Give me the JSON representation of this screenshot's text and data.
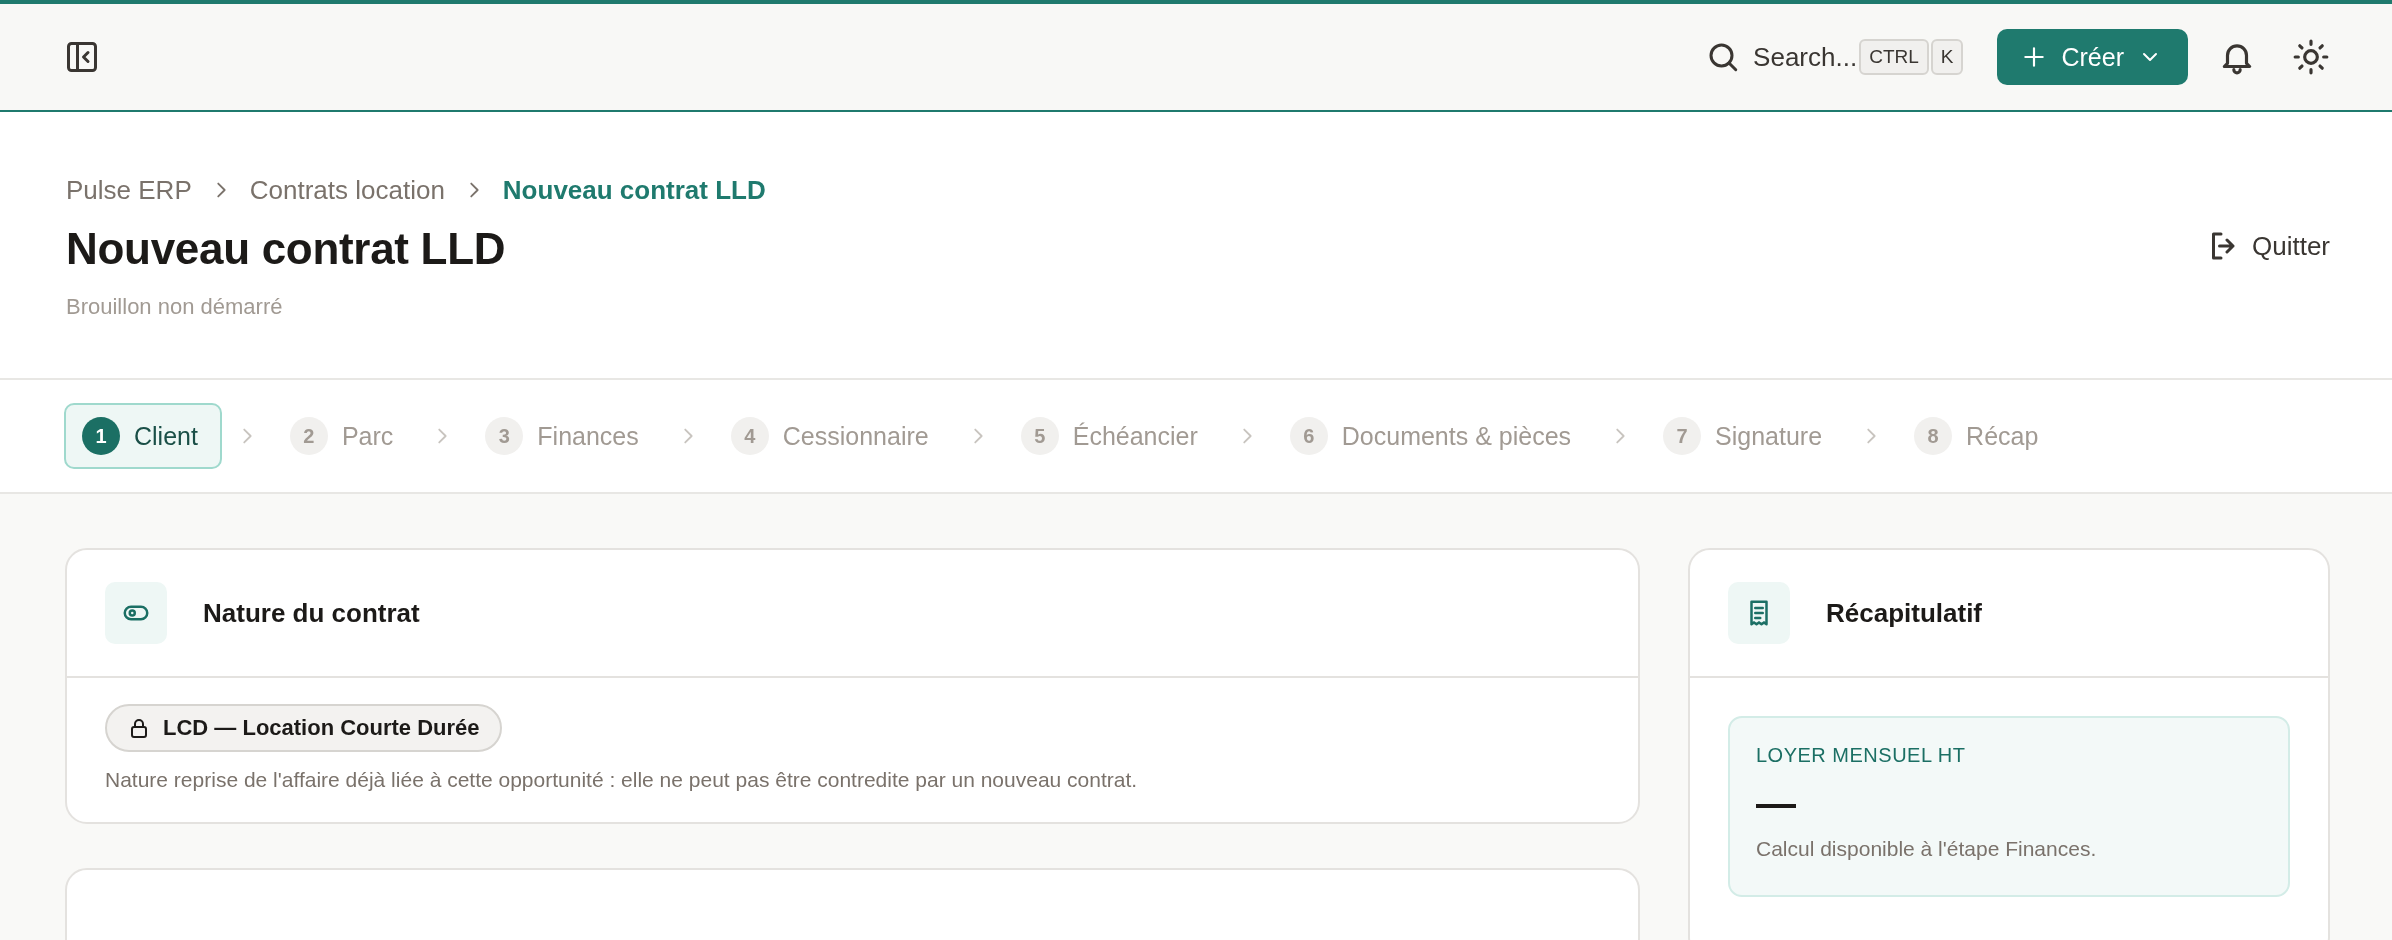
{
  "topbar": {
    "search_label": "Search...",
    "shortcut_keys": [
      "CTRL",
      "K"
    ],
    "create_button": "Créer"
  },
  "breadcrumbs": [
    {
      "label": "Pulse ERP",
      "current": false
    },
    {
      "label": "Contrats location",
      "current": false
    },
    {
      "label": "Nouveau contrat LLD",
      "current": true
    }
  ],
  "page": {
    "title": "Nouveau contrat LLD",
    "subtitle": "Brouillon non démarré",
    "quit_button": "Quitter"
  },
  "steps": [
    {
      "number": "1",
      "label": "Client",
      "selected": true
    },
    {
      "number": "2",
      "label": "Parc",
      "selected": false
    },
    {
      "number": "3",
      "label": "Finances",
      "selected": false
    },
    {
      "number": "4",
      "label": "Cessionnaire",
      "selected": false
    },
    {
      "number": "5",
      "label": "Échéancier",
      "selected": false
    },
    {
      "number": "6",
      "label": "Documents & pièces",
      "selected": false
    },
    {
      "number": "7",
      "label": "Signature",
      "selected": false
    },
    {
      "number": "8",
      "label": "Récap",
      "selected": false
    }
  ],
  "contract_nature": {
    "title": "Nature du contrat",
    "badge": "LCD — Location Courte Durée",
    "note": "Nature reprise de l'affaire déjà liée à cette opportunité : elle ne peut pas être contredite par un nouveau contrat."
  },
  "summary": {
    "title": "Récapitulatif",
    "metric": {
      "label": "LOYER MENSUEL HT",
      "value": "—",
      "hint": "Calcul disponible à l'étape Finances."
    }
  }
}
